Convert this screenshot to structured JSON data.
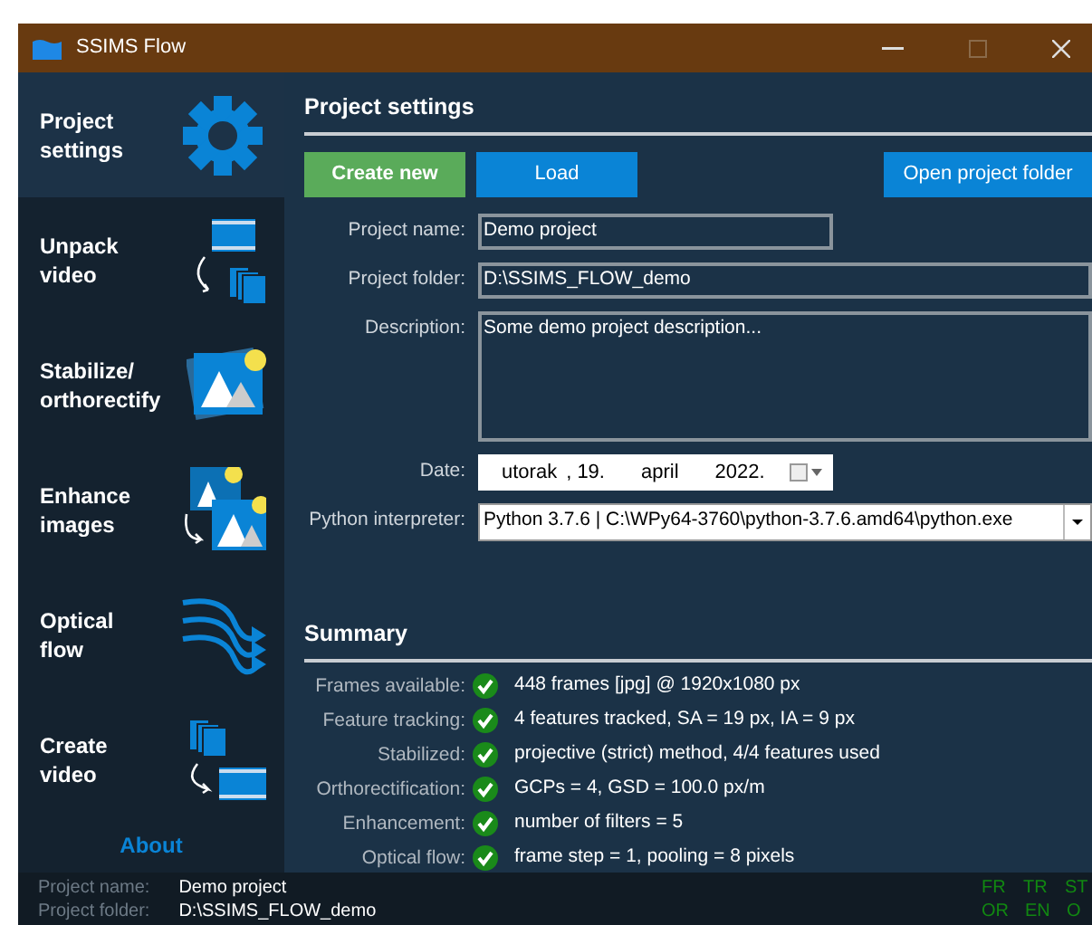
{
  "window": {
    "title": "SSIMS Flow"
  },
  "sidebar": {
    "items": [
      {
        "label": "Project settings",
        "kind": "gear",
        "selected": true
      },
      {
        "label": "Unpack video",
        "kind": "unpack",
        "selected": false
      },
      {
        "label": "Stabilize/ orthorectify",
        "kind": "stabilize",
        "selected": false
      },
      {
        "label": "Enhance images",
        "kind": "enhance",
        "selected": false
      },
      {
        "label": "Optical flow",
        "kind": "flow",
        "selected": false
      },
      {
        "label": "Create video",
        "kind": "create",
        "selected": false
      }
    ],
    "about": "About"
  },
  "project_settings": {
    "heading": "Project settings",
    "buttons": [
      {
        "label": "Create new",
        "kind": "primary"
      },
      {
        "label": "Load",
        "kind": "secondary"
      },
      {
        "label": "Open project folder",
        "kind": "secondary"
      }
    ],
    "project_name": {
      "label": "Project name:",
      "value": "Demo project"
    },
    "project_folder": {
      "label": "Project folder:",
      "value": "D:\\SSIMS_FLOW_demo"
    },
    "description": {
      "label": "Description:",
      "value": "Some demo project description..."
    },
    "date": {
      "label": "Date:",
      "weekday": "utorak",
      "day": ", 19.",
      "month": "april",
      "year": "2022."
    },
    "python_interpreter": {
      "label": "Python interpreter:",
      "value": "Python 3.7.6 | C:\\WPy64-3760\\python-3.7.6.amd64\\python.exe"
    }
  },
  "summary": {
    "heading": "Summary",
    "rows": [
      {
        "label": "Frames available:",
        "ok": true,
        "value": "448 frames [jpg] @ 1920x1080 px"
      },
      {
        "label": "Feature tracking:",
        "ok": true,
        "value": "4 features tracked, SA = 19 px, IA = 9 px"
      },
      {
        "label": "Stabilized:",
        "ok": true,
        "value": "projective (strict) method, 4/4 features used"
      },
      {
        "label": "Orthorectification:",
        "ok": true,
        "value": "GCPs = 4, GSD = 100.0 px/m"
      },
      {
        "label": "Enhancement:",
        "ok": true,
        "value": "number of filters = 5"
      },
      {
        "label": "Optical flow:",
        "ok": true,
        "value": "frame step = 1, pooling = 8 pixels"
      }
    ]
  },
  "status_bar": {
    "project_name_label": "Project name:",
    "project_name": "Demo project",
    "project_folder_label": "Project folder:",
    "project_folder": "D:\\SSIMS_FLOW_demo",
    "flags": [
      [
        "FR",
        "TR",
        "ST"
      ],
      [
        "OR",
        "EN",
        "O"
      ]
    ]
  }
}
